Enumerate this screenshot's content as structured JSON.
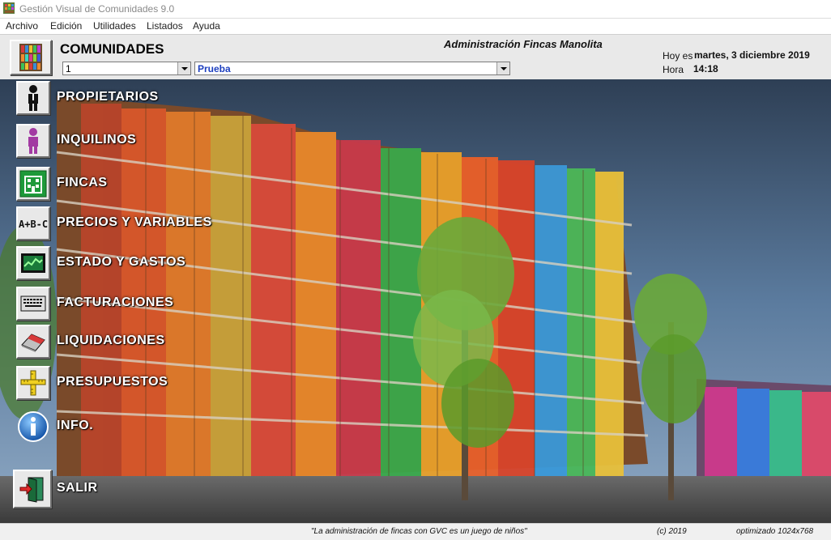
{
  "window": {
    "title": "Gestión  Visual de Comunidades  9.0"
  },
  "menu": [
    "Archivo",
    "Edición",
    "Utilidades",
    "Listados",
    "Ayuda"
  ],
  "header": {
    "section_title": "COMUNIDADES",
    "community_number": "1",
    "community_name": "Prueba",
    "organization": "Administración Fincas Manolita",
    "today_label": "Hoy es",
    "today_value": "martes, 3 diciembre 2019",
    "time_label": "Hora",
    "time_value": "14:18"
  },
  "nav": [
    {
      "label": "PROPIETARIOS",
      "icon": "owner-person-icon"
    },
    {
      "label": "INQUILINOS",
      "icon": "tenant-person-icon"
    },
    {
      "label": "FINCAS",
      "icon": "building-icon"
    },
    {
      "label": "PRECIOS Y VARIABLES",
      "icon": "abc-variables-icon"
    },
    {
      "label": "ESTADO  Y  GASTOS",
      "icon": "chart-monitor-icon"
    },
    {
      "label": "FACTURACIONES",
      "icon": "invoice-keyboard-icon"
    },
    {
      "label": "LIQUIDACIONES",
      "icon": "eraser-settlement-icon"
    },
    {
      "label": "PRESUPUESTOS",
      "icon": "ruler-budget-icon"
    },
    {
      "label": "INFO.",
      "icon": "info-icon"
    },
    {
      "label": "SALIR",
      "icon": "exit-door-icon"
    }
  ],
  "footer": {
    "slogan": "\"La administración de fincas con GVC es un juego de niños\"",
    "copyright": "(c) 2019",
    "optimized": "optimizado 1024x768"
  },
  "colors": {
    "accent_blue": "#1e6fd0",
    "label_text": "#ffffff",
    "sky": "#4f6f92"
  }
}
